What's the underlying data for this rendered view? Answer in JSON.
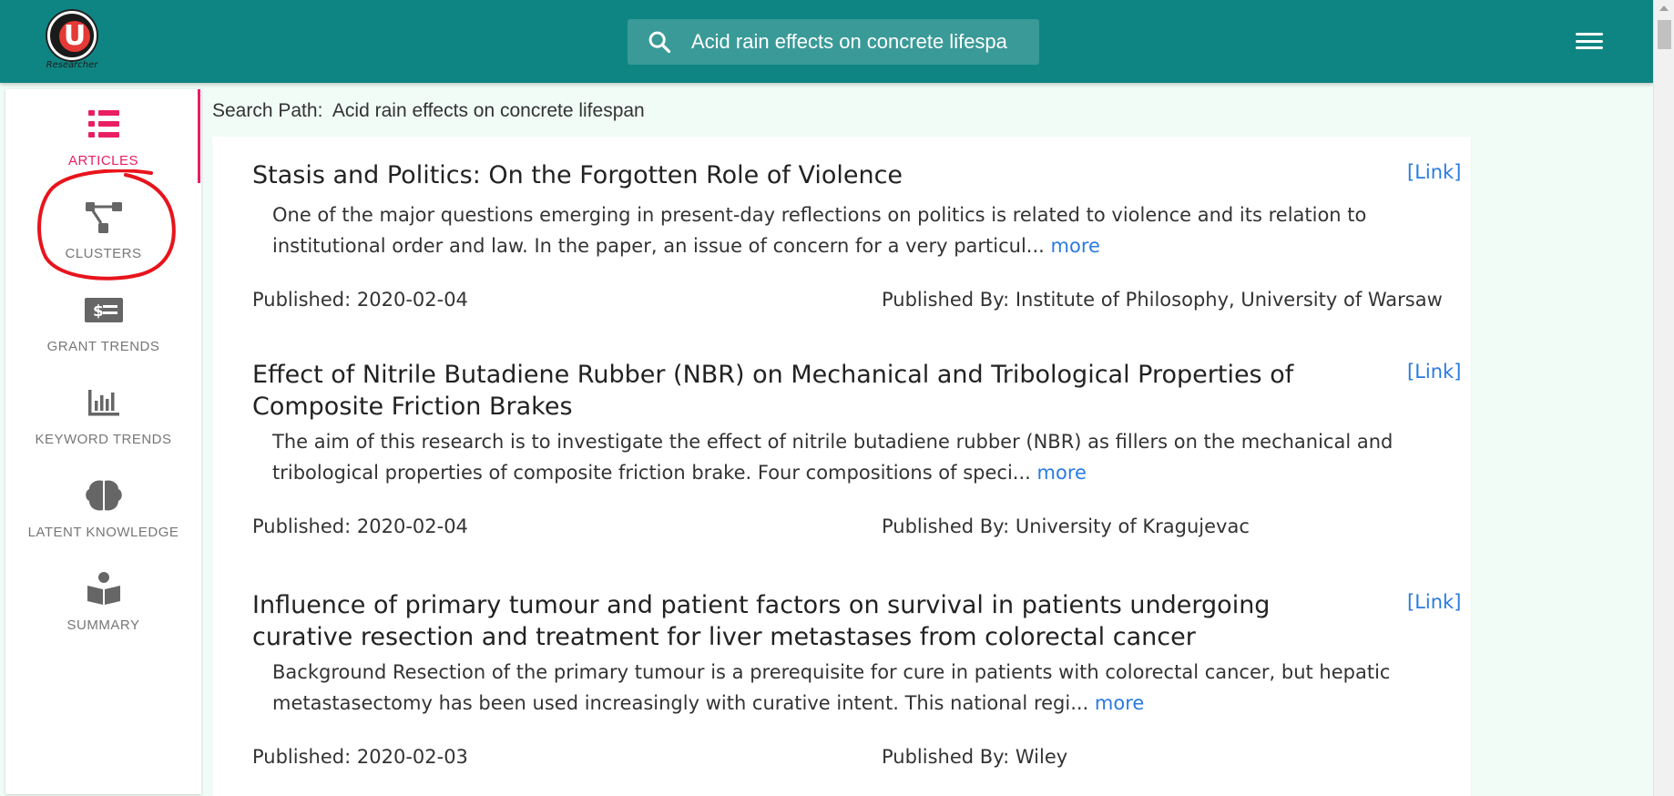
{
  "app": {
    "logo_text": "Researcher",
    "search": {
      "value": "Acid rain effects on concrete lifespa",
      "placeholder": "Search"
    }
  },
  "sidebar": {
    "items": [
      {
        "label": "ARTICLES",
        "icon": "list-icon",
        "active": true
      },
      {
        "label": "CLUSTERS",
        "icon": "sitemap-icon",
        "active": false
      },
      {
        "label": "GRANT TRENDS",
        "icon": "money-check-icon",
        "active": false
      },
      {
        "label": "KEYWORD TRENDS",
        "icon": "bar-chart-icon",
        "active": false
      },
      {
        "label": "LATENT KNOWLEDGE",
        "icon": "brain-icon",
        "active": false
      },
      {
        "label": "SUMMARY",
        "icon": "book-reader-icon",
        "active": false
      }
    ]
  },
  "main": {
    "search_path_label": "Search Path:",
    "search_path_value": "Acid rain effects on concrete lifespan",
    "link_label": "[Link]",
    "more_label": "more",
    "published_label": "Published:",
    "published_by_label": "Published By:",
    "articles": [
      {
        "title": "Stasis and Politics: On the Forgotten Role of Violence",
        "abstract": "One of the major questions emerging in present-day reflections on politics is related to violence and its relation to institutional order and law. In the paper, an issue of concern for a very particul...",
        "published": "2020-02-04",
        "published_by": "Institute of Philosophy, University of Warsaw"
      },
      {
        "title": "Effect of Nitrile Butadiene Rubber (NBR) on Mechanical and Tribological Properties of Composite Friction Brakes",
        "abstract": "The aim of this research is to investigate the effect of nitrile butadiene rubber (NBR) as fillers on the mechanical and tribological properties of composite friction brake. Four compositions of speci...",
        "published": "2020-02-04",
        "published_by": "University of Kragujevac"
      },
      {
        "title": "Influence of primary tumour and patient factors on survival in patients undergoing curative resection and treatment for liver metastases from colorectal cancer",
        "abstract": "Background Resection of the primary tumour is a prerequisite for cure in patients with colorectal cancer, but hepatic metastasectomy has been used increasingly with curative intent. This national regi...",
        "published": "2020-02-03",
        "published_by": "Wiley"
      }
    ]
  },
  "colors": {
    "topbar": "#0f8583",
    "accent_active": "#e91e63",
    "link": "#2a7ae2",
    "annotation": "#e8141c"
  }
}
